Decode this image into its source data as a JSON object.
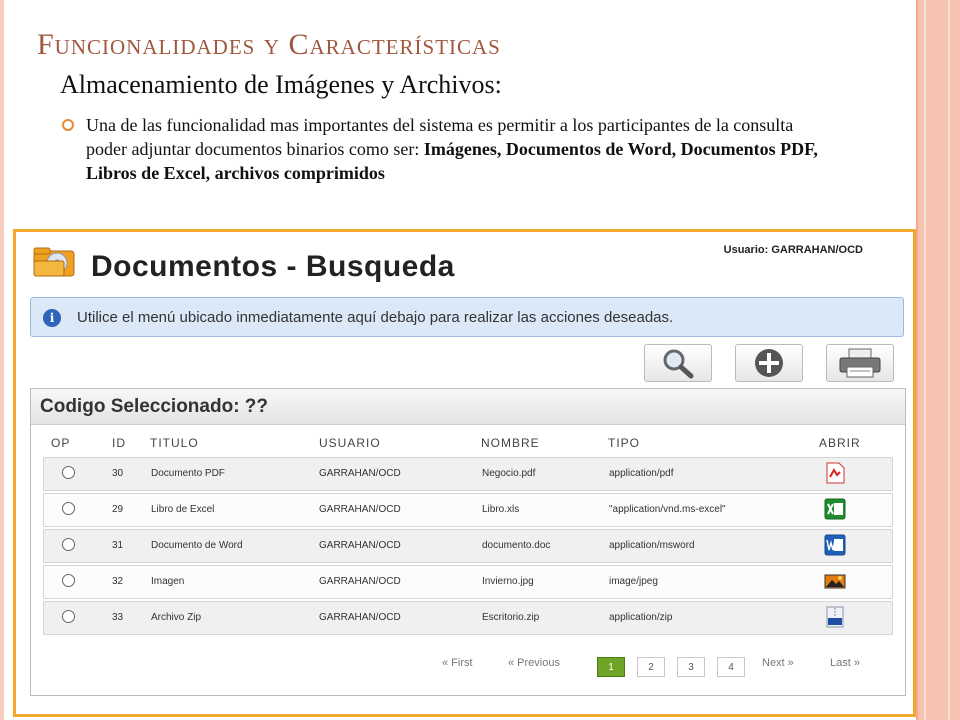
{
  "slide": {
    "title": "Funcionalidades y Características",
    "subtitle": "Almacenamiento de Imágenes y Archivos:",
    "bullet": {
      "text": "Una de las funcionalidad mas importantes del sistema es permitir a los participantes de la consulta poder adjuntar documentos binarios como ser: ",
      "bold": "Imágenes, Documentos de Word, Documentos PDF, Libros de Excel, archivos comprimidos"
    }
  },
  "app": {
    "title": "Documentos - Busqueda",
    "user_label": "Usuario: GARRAHAN/OCD",
    "info_message": "Utilice el menú ubicado inmediatamente aquí debajo para realizar las acciones deseadas.",
    "toolbar": {
      "search_icon": "magnifier-icon",
      "add_icon": "plus-circle-icon",
      "print_icon": "printer-icon"
    },
    "panel_title": "Codigo Seleccionado: ??",
    "columns": [
      "OP",
      "ID",
      "TITULO",
      "USUARIO",
      "NOMBRE",
      "TIPO",
      "ABRIR"
    ],
    "rows": [
      {
        "id": "30",
        "titulo": "Documento PDF",
        "usuario": "GARRAHAN/OCD",
        "nombre": "Negocio.pdf",
        "tipo": "application/pdf",
        "icon": "pdf-icon"
      },
      {
        "id": "29",
        "titulo": "Libro de Excel",
        "usuario": "GARRAHAN/OCD",
        "nombre": "Libro.xls",
        "tipo": "\"application/vnd.ms-excel\"",
        "icon": "excel-icon"
      },
      {
        "id": "31",
        "titulo": "Documento de Word",
        "usuario": "GARRAHAN/OCD",
        "nombre": "documento.doc",
        "tipo": "application/msword",
        "icon": "word-icon"
      },
      {
        "id": "32",
        "titulo": "Imagen",
        "usuario": "GARRAHAN/OCD",
        "nombre": "Invierno.jpg",
        "tipo": "image/jpeg",
        "icon": "image-icon"
      },
      {
        "id": "33",
        "titulo": "Archivo Zip",
        "usuario": "GARRAHAN/OCD",
        "nombre": "Escritorio.zip",
        "tipo": "application/zip",
        "icon": "zip-icon"
      }
    ],
    "pager": {
      "first": "« First",
      "previous": "« Previous",
      "pages": [
        "1",
        "2",
        "3",
        "4"
      ],
      "active_page": "1",
      "next": "Next »",
      "last": "Last »"
    }
  },
  "colors": {
    "title": "#a1573f",
    "frame": "#f0a92a",
    "info_bg": "#dbe8f8",
    "active_page": "#6ea526"
  }
}
